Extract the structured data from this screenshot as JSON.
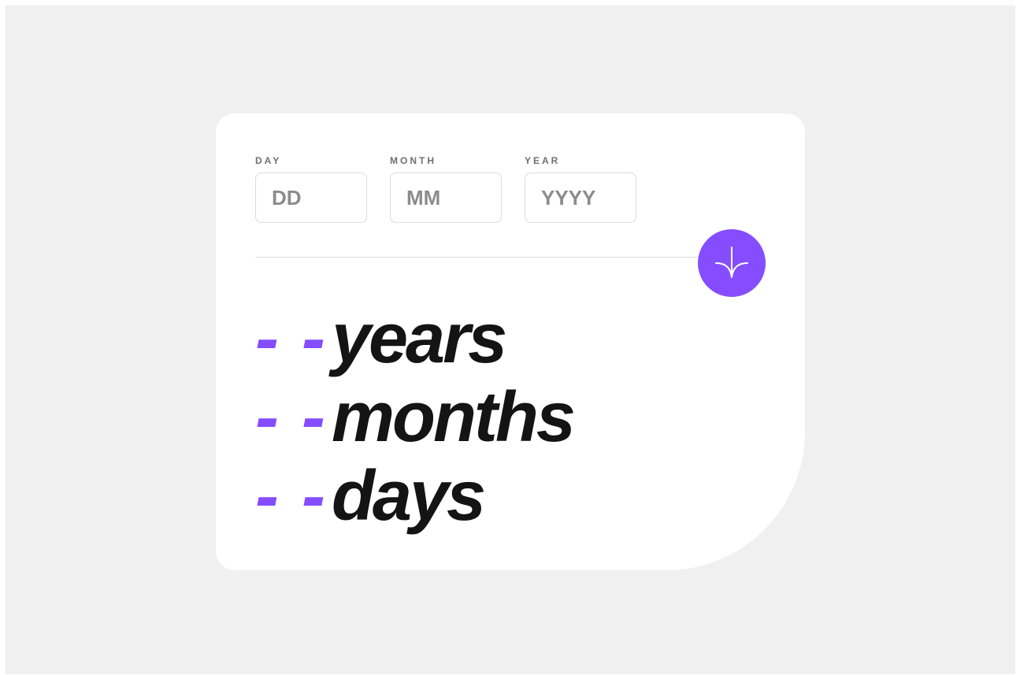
{
  "form": {
    "day": {
      "label": "DAY",
      "value": "",
      "placeholder": "DD"
    },
    "month": {
      "label": "MONTH",
      "value": "",
      "placeholder": "MM"
    },
    "year": {
      "label": "YEAR",
      "value": "",
      "placeholder": "YYYY"
    },
    "submit_icon": "arrow-down-icon"
  },
  "results": {
    "years": {
      "value": "- -",
      "unit": "years"
    },
    "months": {
      "value": "- -",
      "unit": "months"
    },
    "days": {
      "value": "- -",
      "unit": "days"
    }
  },
  "colors": {
    "accent": "#854dff",
    "background": "#f0f0f0",
    "card": "#ffffff",
    "text_dark": "#141414",
    "label_gray": "#716f6f",
    "placeholder_gray": "#8c8c8c",
    "border": "#dcdcdc"
  }
}
